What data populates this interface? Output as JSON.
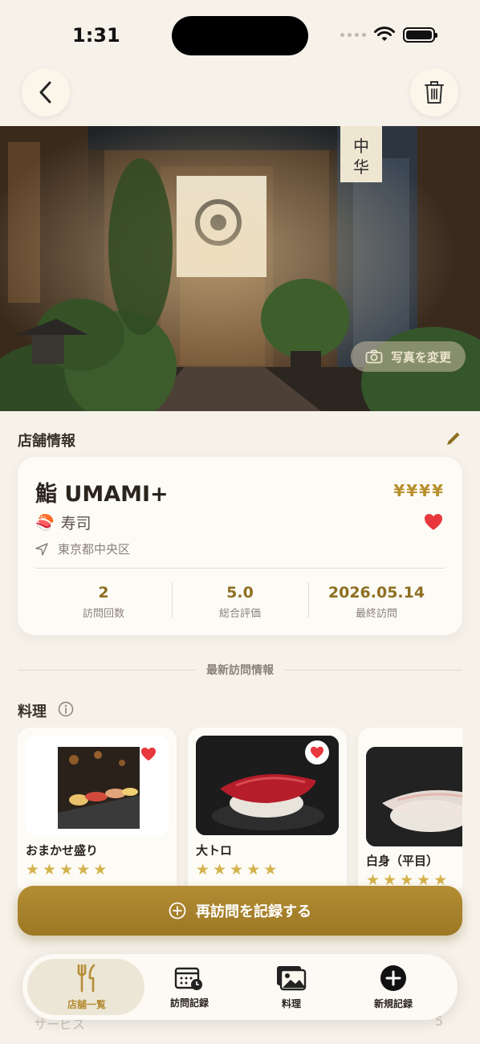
{
  "status_bar": {
    "time": "1:31"
  },
  "hero": {
    "change_photo_label": "写真を変更"
  },
  "store_section": {
    "title": "店舗情報"
  },
  "store": {
    "name": "鮨 UMAMI+",
    "price_level": "¥¥¥¥",
    "cuisine_emoji": "🍣",
    "cuisine": "寿司",
    "location": "東京都中央区",
    "favorite": true
  },
  "stats": [
    {
      "value": "2",
      "label": "訪問回数"
    },
    {
      "value": "5.0",
      "label": "総合評価"
    },
    {
      "value": "2026.05.14",
      "label": "最終訪問"
    }
  ],
  "latest_visit": {
    "label": "最新訪問情報"
  },
  "dishes_section": {
    "title": "料理"
  },
  "dishes": [
    {
      "name": "おまかせ盛り",
      "rating": 5,
      "favorite": true
    },
    {
      "name": "大トロ",
      "rating": 5,
      "favorite": true
    },
    {
      "name": "白身（平目）",
      "rating": 5,
      "favorite": false
    }
  ],
  "partial_row": {
    "label": "サービス",
    "value": "5"
  },
  "cta": {
    "label": "再訪問を記録する"
  },
  "tabs": [
    {
      "label": "店舗一覧",
      "icon": "fork-knife-icon",
      "active": true
    },
    {
      "label": "訪問記録",
      "icon": "calendar-clock-icon",
      "active": false
    },
    {
      "label": "料理",
      "icon": "photos-icon",
      "active": false
    },
    {
      "label": "新規記録",
      "icon": "plus-circle-icon",
      "active": false
    }
  ],
  "colors": {
    "accent": "#b48c34",
    "background": "#f6f2ea",
    "heart": "#e8383d",
    "star": "#d4b24c"
  }
}
